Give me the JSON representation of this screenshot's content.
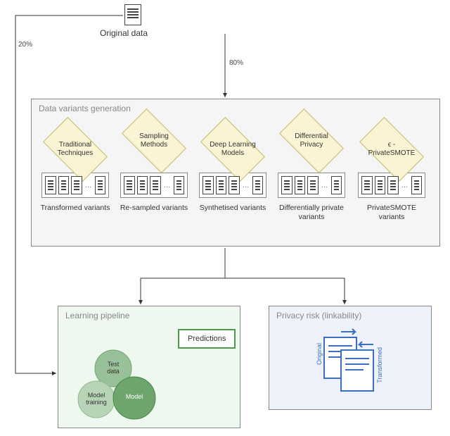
{
  "root": {
    "label": "Original data",
    "split_left": "20%",
    "split_right": "80%"
  },
  "variants_zone": {
    "title": "Data variants generation",
    "columns": [
      {
        "diamond": "Traditional Techniques",
        "label": "Transformed variants"
      },
      {
        "diamond": "Sampling Methods",
        "label": "Re-sampled variants"
      },
      {
        "diamond": "Deep Learning Models",
        "label": "Synthetised variants"
      },
      {
        "diamond": "Differential Privacy",
        "label": "Differentially private variants"
      },
      {
        "diamond": "ϵ - PrivateSMOTE",
        "label": "PrivateSMOTE variants"
      }
    ]
  },
  "learning_zone": {
    "title": "Learning pipeline",
    "gears": {
      "a": "Test data",
      "b": "Model training",
      "c": "Model"
    },
    "output": "Predictions"
  },
  "privacy_zone": {
    "title": "Privacy risk (linkability)",
    "left_doc": "Original",
    "right_doc": "Transformed"
  },
  "chart_data": {
    "type": "diagram",
    "nodes": [
      {
        "id": "original",
        "label": "Original data"
      },
      {
        "id": "variants",
        "label": "Data variants generation",
        "children": [
          "Traditional Techniques",
          "Sampling Methods",
          "Deep Learning Models",
          "Differential Privacy",
          "ϵ - PrivateSMOTE"
        ],
        "outputs": [
          "Transformed variants",
          "Re-sampled variants",
          "Synthetised variants",
          "Differentially private variants",
          "PrivateSMOTE variants"
        ]
      },
      {
        "id": "learning",
        "label": "Learning pipeline",
        "components": [
          "Test data",
          "Model training",
          "Model",
          "Predictions"
        ]
      },
      {
        "id": "privacy",
        "label": "Privacy risk (linkability)",
        "components": [
          "Original",
          "Transformed"
        ]
      }
    ],
    "edges": [
      {
        "from": "original",
        "to": "variants",
        "label": "80%"
      },
      {
        "from": "original",
        "to": "learning",
        "label": "20%"
      },
      {
        "from": "variants",
        "to": "learning"
      },
      {
        "from": "variants",
        "to": "privacy"
      }
    ]
  }
}
